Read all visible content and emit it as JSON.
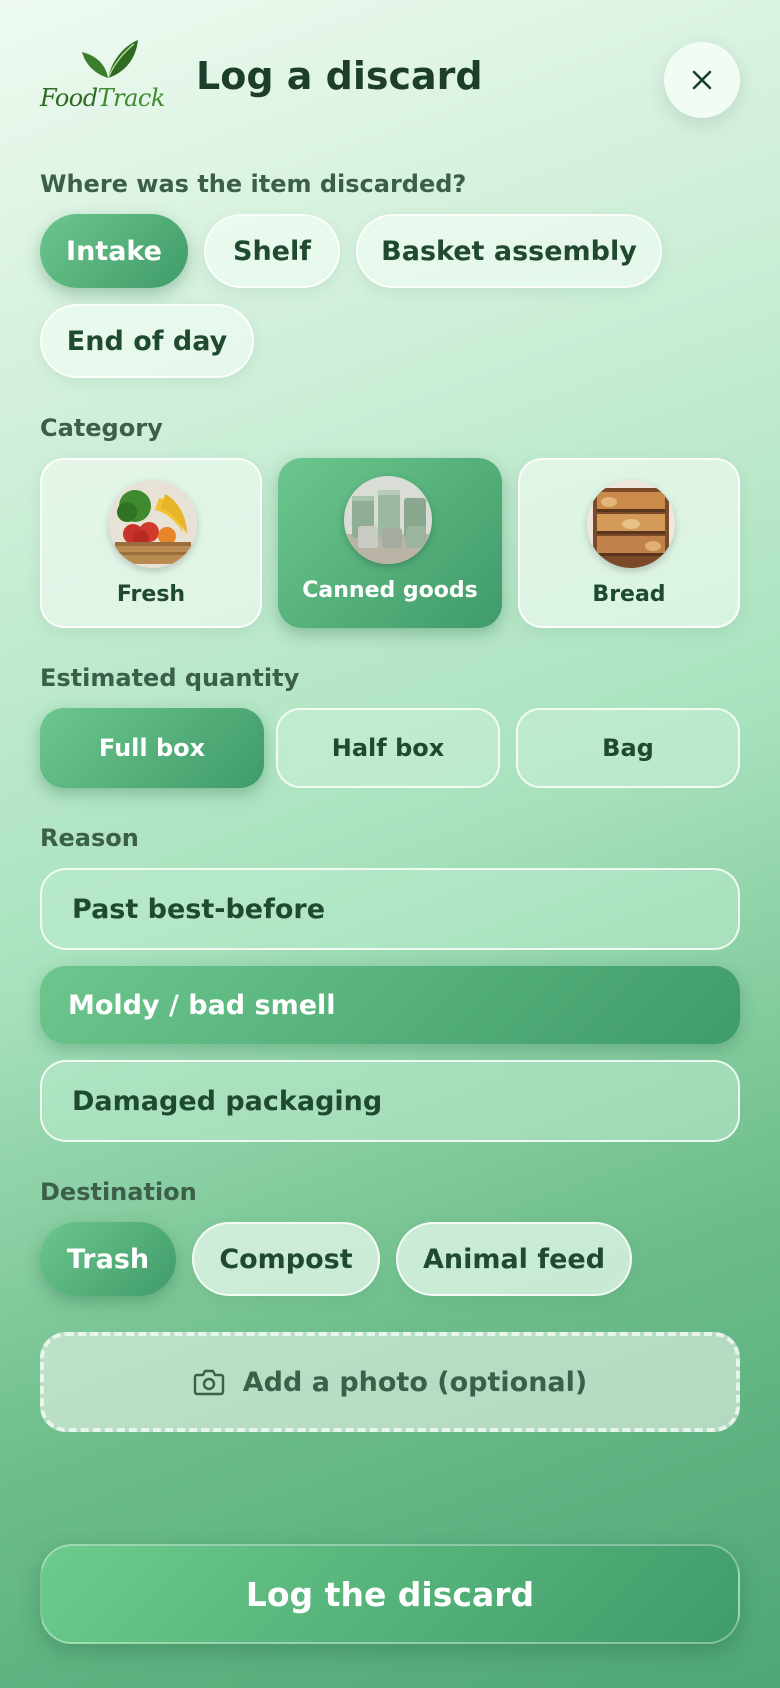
{
  "header": {
    "logo_text_1": "Food",
    "logo_text_2": "Track",
    "title": "Log a discard",
    "close_icon": "close-icon"
  },
  "location": {
    "label": "Where was the item discarded?",
    "options": [
      "Intake",
      "Shelf",
      "Basket assembly",
      "End of day"
    ],
    "selected": "Intake"
  },
  "category": {
    "label": "Category",
    "options": [
      {
        "label": "Fresh",
        "image": "fresh-produce-crate"
      },
      {
        "label": "Canned goods",
        "image": "canned-goods"
      },
      {
        "label": "Bread",
        "image": "bread-shelves"
      }
    ],
    "selected": "Canned goods"
  },
  "quantity": {
    "label": "Estimated quantity",
    "options": [
      "Full box",
      "Half box",
      "Bag"
    ],
    "selected": "Full box"
  },
  "reason": {
    "label": "Reason",
    "options": [
      "Past best-before",
      "Moldy / bad smell",
      "Damaged packaging"
    ],
    "selected": "Moldy / bad smell"
  },
  "destination": {
    "label": "Destination",
    "options": [
      "Trash",
      "Compost",
      "Animal feed"
    ],
    "selected": "Trash"
  },
  "photo": {
    "label": "Add a photo (optional)",
    "icon": "camera-icon"
  },
  "submit": {
    "label": "Log the discard"
  },
  "colors": {
    "accent": "#4fae78",
    "text": "#1f4a30"
  }
}
